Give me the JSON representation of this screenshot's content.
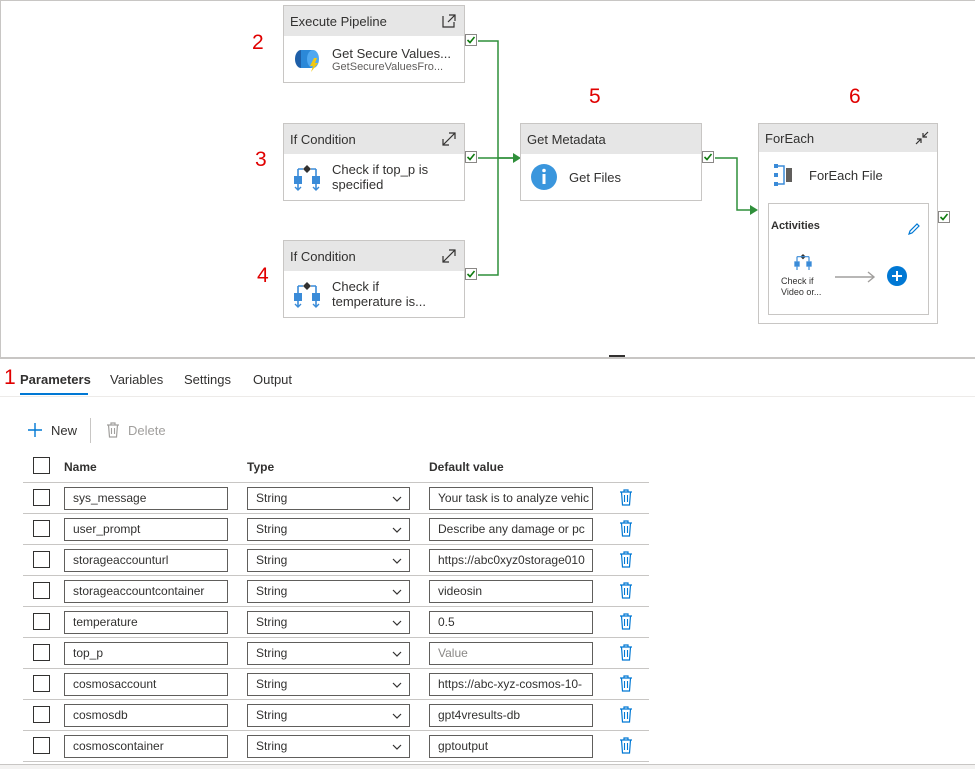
{
  "step_numbers": [
    "1",
    "2",
    "3",
    "4",
    "5",
    "6"
  ],
  "activities": {
    "execute_pipeline": {
      "type": "Execute Pipeline",
      "name": "Get Secure Values...",
      "sub": "GetSecureValuesFro..."
    },
    "if_top_p": {
      "type": "If Condition",
      "name_line1": "Check if top_p is",
      "name_line2": "specified"
    },
    "if_temperature": {
      "type": "If Condition",
      "name_line1": "Check if",
      "name_line2": "temperature is..."
    },
    "get_metadata": {
      "type": "Get Metadata",
      "name": "Get Files"
    },
    "foreach": {
      "type": "ForEach",
      "name": "ForEach File",
      "activities_label": "Activities",
      "inner_line1": "Check if",
      "inner_line2": "Video or..."
    }
  },
  "tabs": [
    {
      "label": "Parameters",
      "active": true
    },
    {
      "label": "Variables",
      "active": false
    },
    {
      "label": "Settings",
      "active": false
    },
    {
      "label": "Output",
      "active": false
    }
  ],
  "toolbar": {
    "new_label": "New",
    "delete_label": "Delete"
  },
  "grid": {
    "headers": {
      "name": "Name",
      "type": "Type",
      "default": "Default value"
    },
    "rows": [
      {
        "name": "sys_message",
        "type": "String",
        "default": "Your task is to analyze vehic",
        "placeholder": false
      },
      {
        "name": "user_prompt",
        "type": "String",
        "default": "Describe any damage or pc",
        "placeholder": false
      },
      {
        "name": "storageaccounturl",
        "type": "String",
        "default": "https://abc0xyz0storage010",
        "placeholder": false
      },
      {
        "name": "storageaccountcontainer",
        "type": "String",
        "default": "videosin",
        "placeholder": false
      },
      {
        "name": "temperature",
        "type": "String",
        "default": "0.5",
        "placeholder": false
      },
      {
        "name": "top_p",
        "type": "String",
        "default": "Value",
        "placeholder": true
      },
      {
        "name": "cosmosaccount",
        "type": "String",
        "default": "https://abc-xyz-cosmos-10-",
        "placeholder": false
      },
      {
        "name": "cosmosdb",
        "type": "String",
        "default": "gpt4vresults-db",
        "placeholder": false
      },
      {
        "name": "cosmoscontainer",
        "type": "String",
        "default": "gptoutput",
        "placeholder": false
      }
    ]
  },
  "colors": {
    "accent": "#0078d4",
    "success": "#107c10",
    "connector": "#2f8f3a",
    "step_number": "#e00000"
  },
  "icons": [
    "external-link-icon",
    "expand-icon",
    "collapse-icon",
    "check-icon",
    "info-icon",
    "plus-icon",
    "trash-icon",
    "pencil-icon",
    "chevron-down-icon",
    "arrow-right-icon"
  ]
}
